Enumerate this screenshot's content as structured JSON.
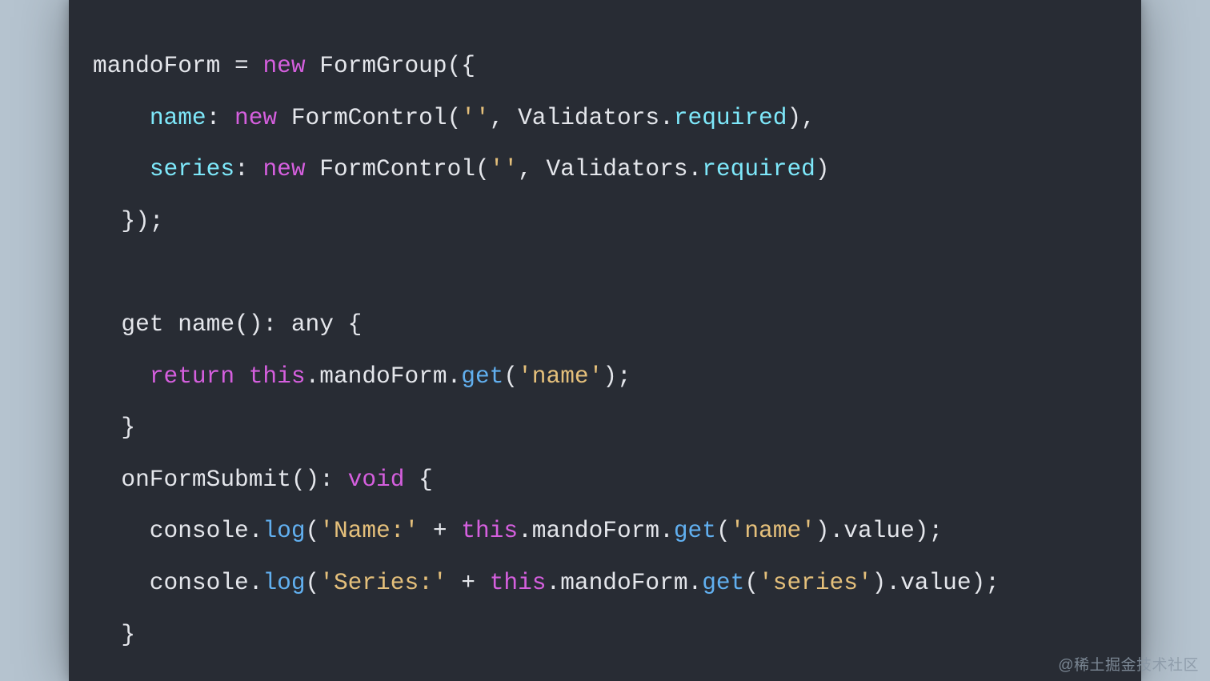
{
  "code": {
    "l1": {
      "a": "mandoForm ",
      "b": "= ",
      "c": "new",
      "d": " FormGroup({"
    },
    "l2": {
      "a": "    ",
      "b": "name",
      "c": ": ",
      "d": "new",
      "e": " FormControl(",
      "f": "''",
      "g": ", Validators.",
      "h": "required",
      "i": "),"
    },
    "l3": {
      "a": "    ",
      "b": "series",
      "c": ": ",
      "d": "new",
      "e": " FormControl(",
      "f": "''",
      "g": ", Validators.",
      "h": "required",
      "i": ")"
    },
    "l4": {
      "a": "  });"
    },
    "l5": {
      "a": ""
    },
    "l6": {
      "a": "  get name(): any {"
    },
    "l7": {
      "a": "    ",
      "b": "return",
      "c": " ",
      "d": "this",
      "e": ".mandoForm.",
      "f": "get",
      "g": "(",
      "h": "'name'",
      "i": ");"
    },
    "l8": {
      "a": "  }"
    },
    "l9": {
      "a": "  onFormSubmit(): ",
      "b": "void",
      "c": " {"
    },
    "l10": {
      "a": "    console.",
      "b": "log",
      "c": "(",
      "d": "'Name:'",
      "e": " + ",
      "f": "this",
      "g": ".mandoForm.",
      "h": "get",
      "i": "(",
      "j": "'name'",
      "k": ").value);"
    },
    "l11": {
      "a": "    console.",
      "b": "log",
      "c": "(",
      "d": "'Series:'",
      "e": " + ",
      "f": "this",
      "g": ".mandoForm.",
      "h": "get",
      "i": "(",
      "j": "'series'",
      "k": ").value);"
    },
    "l12": {
      "a": "  }"
    }
  },
  "watermark": "@稀土掘金技术社区"
}
